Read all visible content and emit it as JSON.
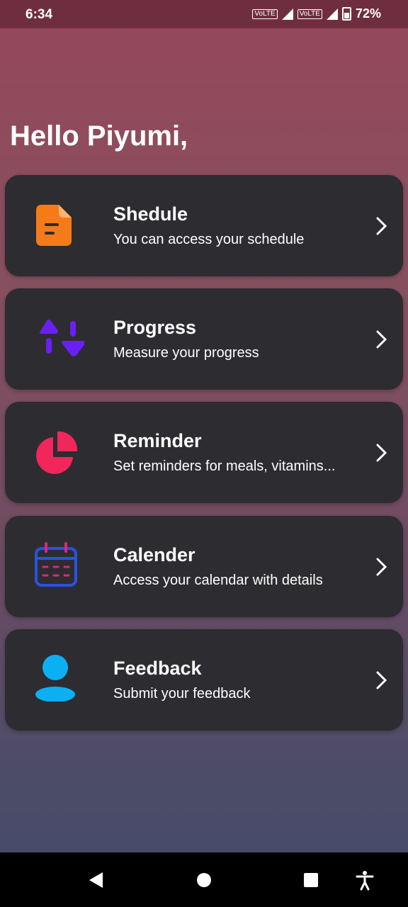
{
  "status_bar": {
    "time": "6:34",
    "battery": "72%",
    "network_1": "VoLTE",
    "network_2": "VoLTE",
    "network_type": "4G"
  },
  "greeting": "Hello Piyumi,",
  "cards": [
    {
      "title": "Shedule",
      "subtitle": "You can access your schedule",
      "icon": "document-icon",
      "color": "#f47b18"
    },
    {
      "title": "Progress",
      "subtitle": "Measure your progress",
      "icon": "sort-arrows-icon",
      "color": "#6a1ff5"
    },
    {
      "title": "Reminder",
      "subtitle": "Set reminders for meals, vitamins...",
      "icon": "pie-chart-icon",
      "color": "#f1265a"
    },
    {
      "title": "Calender",
      "subtitle": "Access your calendar with details",
      "icon": "calendar-icon",
      "color": "#2a52e0"
    },
    {
      "title": "Feedback",
      "subtitle": "Submit your feedback",
      "icon": "user-icon",
      "color": "#0ab0f2"
    }
  ],
  "nav": [
    "back-icon",
    "home-icon",
    "recents-icon",
    "accessibility-icon"
  ]
}
